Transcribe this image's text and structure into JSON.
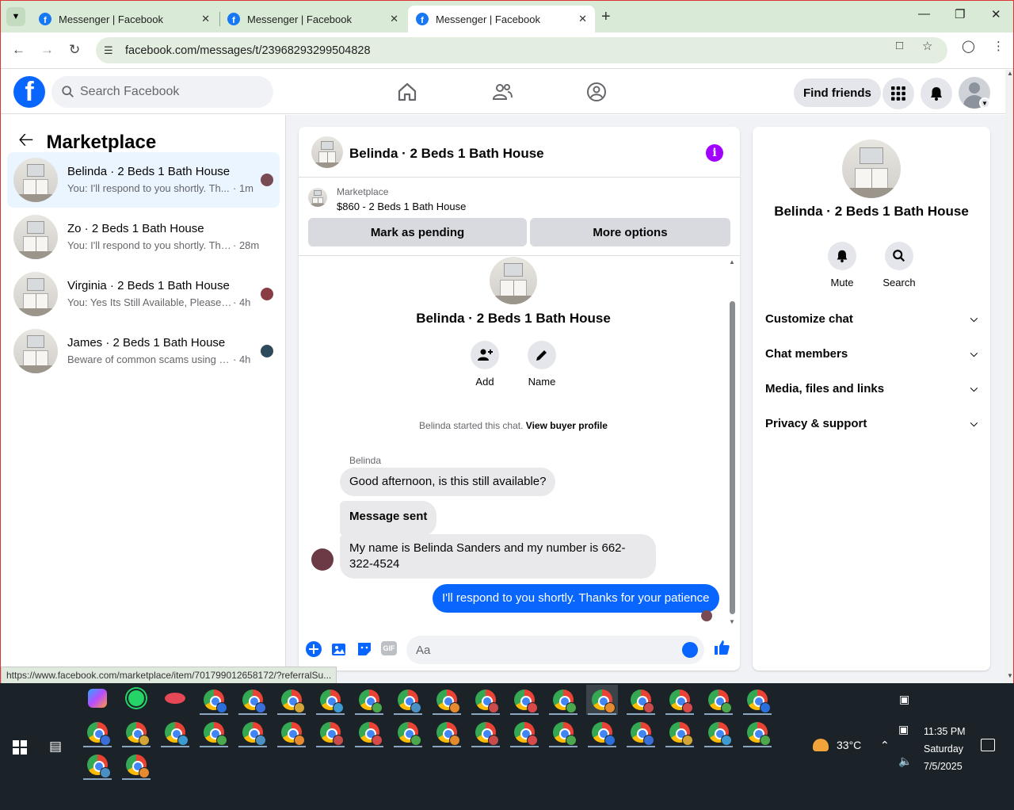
{
  "browser": {
    "tabs": [
      {
        "title": "Messenger | Facebook",
        "active": false
      },
      {
        "title": "Messenger | Facebook",
        "active": false
      },
      {
        "title": "Messenger | Facebook",
        "active": true
      }
    ],
    "url": "facebook.com/messages/t/23968293299504828",
    "status_url": "https://www.facebook.com/marketplace/item/701799012658172/?referralSu..."
  },
  "fb": {
    "logo_letter": "f",
    "search_placeholder": "Search Facebook",
    "find_friends": "Find friends"
  },
  "left": {
    "title": "Marketplace",
    "conversations": [
      {
        "title": "Belinda · 2 Beds 1 Bath House",
        "snippet": "You: I'll respond to you shortly. Th...",
        "time": "· 1m",
        "mini_color": "#7a4a52"
      },
      {
        "title": "Zo · 2 Beds 1 Bath House",
        "snippet": "You: I'll respond to you shortly. Tha...",
        "time": "· 28m",
        "mini_color": ""
      },
      {
        "title": "Virginia · 2 Beds 1 Bath House",
        "snippet": "You: Yes Its Still Available, Please Se...",
        "time": "· 4h",
        "mini_color": "#8a3c44"
      },
      {
        "title": "James · 2 Beds 1 Bath House",
        "snippet": "Beware of common scams using p...",
        "time": "· 4h",
        "mini_color": "#2f4a5a"
      }
    ]
  },
  "chat": {
    "header_name": "Belinda · 2 Beds 1 Bath House",
    "marketplace_label": "Marketplace",
    "item": "$860 - 2 Beds 1 Bath House",
    "mark_pending": "Mark as pending",
    "more_options": "More options",
    "conv_name": "Belinda · 2 Beds 1 Bath House",
    "add_label": "Add",
    "name_label": "Name",
    "started_text": "Belinda started this chat.",
    "view_profile": "View buyer profile",
    "sender": "Belinda",
    "messages": [
      {
        "text": "Good afternoon, is this still available?",
        "dir": "in"
      },
      {
        "text": "Message sent",
        "dir": "in"
      },
      {
        "text": "My name is Belinda Sanders and my number is 662-322-4524",
        "dir": "in"
      },
      {
        "text": "I'll respond to you shortly. Thanks for your patience",
        "dir": "out"
      }
    ],
    "composer_placeholder": "Aa",
    "gif_label": "GIF"
  },
  "right": {
    "name": "Belinda · 2 Beds 1 Bath House",
    "mute": "Mute",
    "search": "Search",
    "sections": [
      "Customize chat",
      "Chat members",
      "Media, files and links",
      "Privacy & support"
    ]
  },
  "taskbar": {
    "temperature": "33°C",
    "time": "11:35 PM",
    "day": "Saturday",
    "date": "7/5/2025"
  },
  "colors": {
    "fb_blue": "#0866ff",
    "info_purple": "#a200ff",
    "active_conv": "#ebf5ff",
    "tabbar": "#d9ebd6"
  }
}
